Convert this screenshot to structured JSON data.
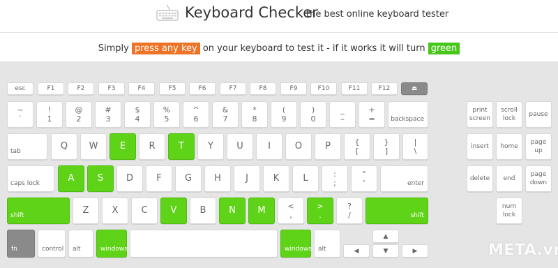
{
  "header": {
    "title": "Keyboard Checker",
    "subtitle": "the best online keyboard tester",
    "icon": "keyboard-icon"
  },
  "instructions": {
    "before": "Simply ",
    "press_key": "press any key",
    "middle": " on your keyboard to test it - if it works it will turn ",
    "green": "green",
    "colors": {
      "orange": "#ee7326",
      "green": "#47c71b",
      "pressed": "#5fd317"
    }
  },
  "keys": {
    "esc": "esc",
    "f1": "F1",
    "f2": "F2",
    "f3": "F3",
    "f4": "F4",
    "f5": "F5",
    "f6": "F6",
    "f7": "F7",
    "f8": "F8",
    "f9": "F9",
    "f10": "F10",
    "f11": "F11",
    "f12": "F12",
    "eject": "⏏",
    "tilde_top": "~",
    "tilde_bot": "`",
    "k1_top": "!",
    "k1_bot": "1",
    "k2_top": "@",
    "k2_bot": "2",
    "k3_top": "#",
    "k3_bot": "3",
    "k4_top": "$",
    "k4_bot": "4",
    "k5_top": "%",
    "k5_bot": "5",
    "k6_top": "^",
    "k6_bot": "6",
    "k7_top": "&",
    "k7_bot": "7",
    "k8_top": "*",
    "k8_bot": "8",
    "k9_top": "(",
    "k9_bot": "9",
    "k0_top": ")",
    "k0_bot": "0",
    "minus_top": "_",
    "minus_bot": "–",
    "plus_top": "+",
    "plus_bot": "=",
    "backspace": "backspace",
    "tab": "tab",
    "q": "Q",
    "w": "W",
    "e": "E",
    "r": "R",
    "t": "T",
    "y": "Y",
    "u": "U",
    "i": "I",
    "o": "O",
    "p": "P",
    "lbrace_top": "{",
    "lbrace_bot": "[",
    "rbrace_top": "}",
    "rbrace_bot": "]",
    "pipe_top": "|",
    "pipe_bot": "\\",
    "caps": "caps lock",
    "a": "A",
    "s": "S",
    "d": "D",
    "f": "F",
    "g": "G",
    "h": "H",
    "j": "J",
    "k": "K",
    "l": "L",
    "colon_top": ":",
    "colon_bot": ";",
    "quote_top": "\"",
    "quote_bot": "'",
    "enter": "enter",
    "shift_l": "shift",
    "z": "Z",
    "x": "X",
    "c": "C",
    "v": "V",
    "b": "B",
    "n": "N",
    "m": "M",
    "lt_top": "<",
    "lt_bot": ",",
    "gt_top": ">",
    "gt_bot": ".",
    "q_top": "?",
    "q_bot": "/",
    "shift_r": "shift",
    "fn": "fn",
    "control": "control",
    "alt_l": "alt",
    "windows_l": "windows",
    "windows_r": "windows",
    "alt_r": "alt",
    "arrow_up": "▲",
    "arrow_left": "◀",
    "arrow_down": "▼",
    "arrow_right": "▶",
    "print_screen_1": "print",
    "print_screen_2": "screen",
    "scroll_lock_1": "scroll",
    "scroll_lock_2": "lock",
    "pause": "pause",
    "insert": "insert",
    "home": "home",
    "page_up_1": "page",
    "page_up_2": "up",
    "delete": "delete",
    "end": "end",
    "page_down_1": "page",
    "page_down_2": "down",
    "num_lock_1": "num",
    "num_lock_2": "lock"
  },
  "pressed_keys": [
    "E",
    "T",
    "A",
    "S",
    "V",
    "N",
    "M",
    ">",
    "shift (left)",
    "shift (right)",
    "windows (left)",
    "windows (right)"
  ],
  "watermark": "META.vn"
}
